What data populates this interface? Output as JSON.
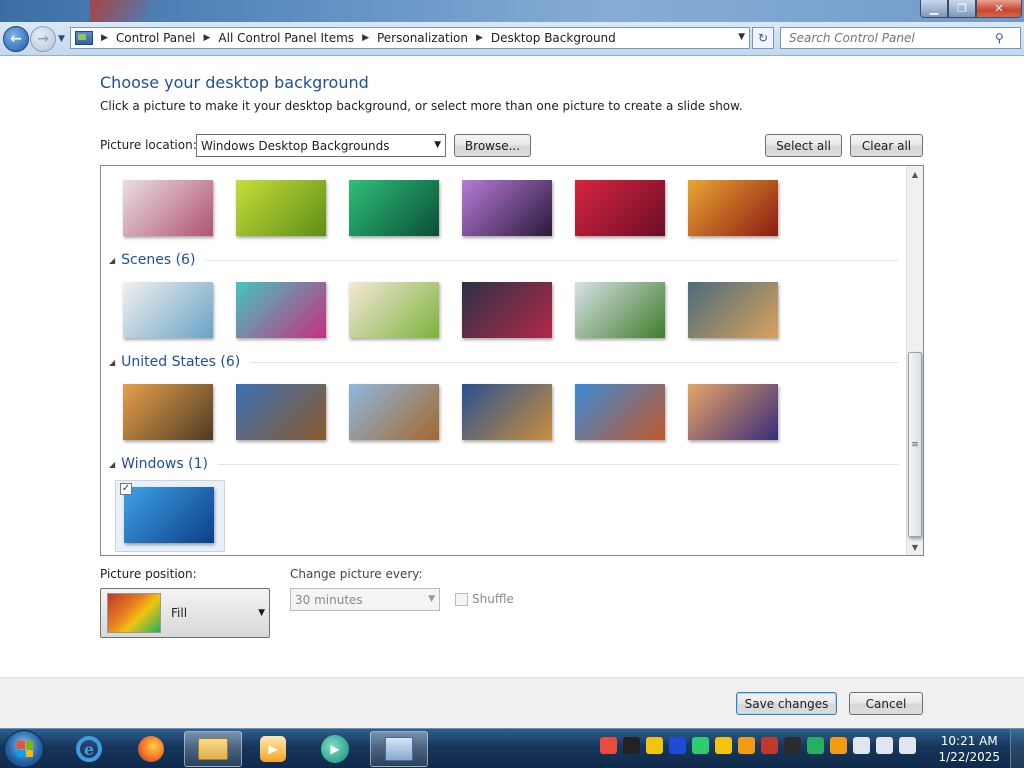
{
  "window": {
    "controls": {
      "minimize": "▁",
      "maximize": "❐",
      "close": "✕"
    }
  },
  "address": {
    "crumbs": [
      "Control Panel",
      "All Control Panel Items",
      "Personalization",
      "Desktop Background"
    ],
    "search_placeholder": "Search Control Panel"
  },
  "page": {
    "heading": "Choose your desktop background",
    "instruction": "Click a picture to make it your desktop background, or select more than one picture to create a slide show.",
    "picture_location_label": "Picture location:",
    "picture_location_value": "Windows Desktop Backgrounds",
    "browse_label": "Browse...",
    "select_all_label": "Select all",
    "clear_all_label": "Clear all"
  },
  "gallery": {
    "groups": [
      {
        "name": "",
        "thumbnails": [
          {
            "colors": [
              "#e8dfe6",
              "#b2526e"
            ]
          },
          {
            "colors": [
              "#c6de3a",
              "#5f8e16"
            ]
          },
          {
            "colors": [
              "#2ebf7a",
              "#0a4f36"
            ]
          },
          {
            "colors": [
              "#b77ad8",
              "#2a1a3a"
            ]
          },
          {
            "colors": [
              "#d8253f",
              "#6d0c28"
            ]
          },
          {
            "colors": [
              "#e9a632",
              "#8c1a13"
            ]
          }
        ]
      },
      {
        "name": "Scenes (6)",
        "thumbnails": [
          {
            "colors": [
              "#f2f0ee",
              "#6aa3c8"
            ]
          },
          {
            "colors": [
              "#43c6c0",
              "#c4307e"
            ]
          },
          {
            "colors": [
              "#f6e7d8",
              "#7cb33b"
            ]
          },
          {
            "colors": [
              "#2b3246",
              "#b2284a"
            ]
          },
          {
            "colors": [
              "#d8e1e6",
              "#3f7d2c"
            ]
          },
          {
            "colors": [
              "#4a6c7d",
              "#d8a25d"
            ]
          }
        ]
      },
      {
        "name": "United States (6)",
        "thumbnails": [
          {
            "colors": [
              "#e7a04a",
              "#4d3b23"
            ]
          },
          {
            "colors": [
              "#3c6fb5",
              "#8a5b2c"
            ]
          },
          {
            "colors": [
              "#8fb8e0",
              "#a2682e"
            ]
          },
          {
            "colors": [
              "#2a4f92",
              "#c8913c"
            ]
          },
          {
            "colors": [
              "#3a8ad6",
              "#c1592c"
            ]
          },
          {
            "colors": [
              "#e7a466",
              "#3a2c7a"
            ]
          }
        ]
      },
      {
        "name": "Windows (1)",
        "thumbnails": [
          {
            "colors": [
              "#3ea2e6",
              "#0b3e8a"
            ],
            "checked": "✓"
          }
        ]
      }
    ]
  },
  "position": {
    "label": "Picture position:",
    "value": "Fill"
  },
  "slideshow": {
    "interval_label": "Change picture every:",
    "interval_value": "30 minutes",
    "shuffle_label": "Shuffle"
  },
  "footer": {
    "save_label": "Save changes",
    "cancel_label": "Cancel"
  },
  "taskbar": {
    "time": "10:21 AM",
    "date": "1/22/2025",
    "tray_colors": [
      "#e74c3c",
      "#222222",
      "#f1c40f",
      "#1e4bd6",
      "#2ecc71",
      "#f1c40f",
      "#f39c12",
      "#c0392b",
      "#2c2c2c",
      "#27ae60",
      "#f39c12",
      "#dfe6ee",
      "#dfe6ee",
      "#dfe6ee"
    ]
  }
}
